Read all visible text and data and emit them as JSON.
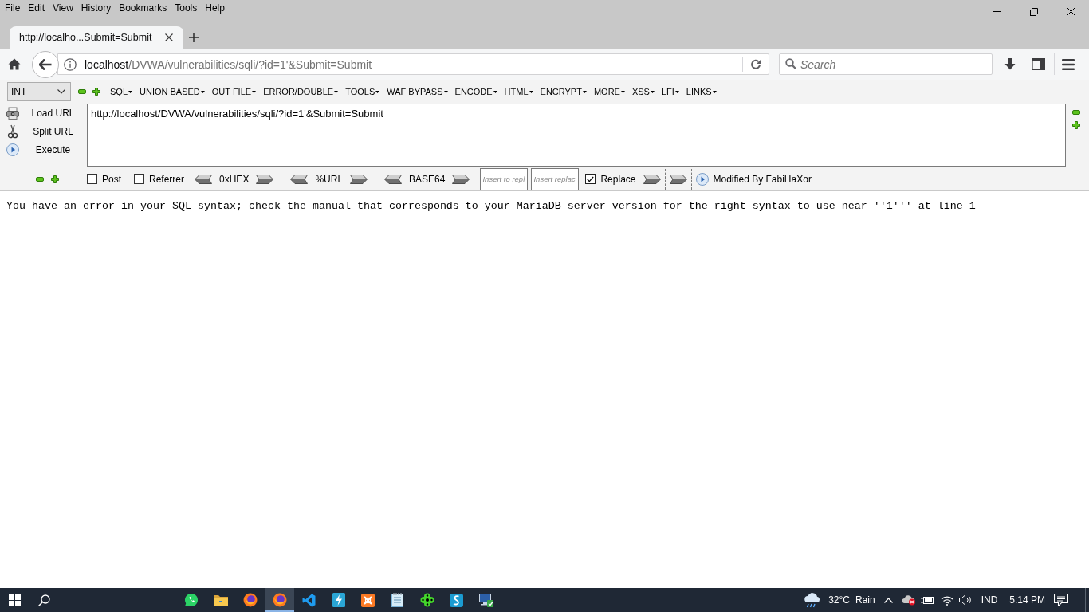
{
  "menu_bar": {
    "items": [
      "File",
      "Edit",
      "View",
      "History",
      "Bookmarks",
      "Tools",
      "Help"
    ]
  },
  "tabs": [
    {
      "title": "http://localho...Submit=Submit",
      "selected": true
    }
  ],
  "address_bar": {
    "host": "localhost",
    "path": "/DVWA/vulnerabilities/sqli/?id=1'&Submit=Submit"
  },
  "search": {
    "placeholder": "Search"
  },
  "hackbar": {
    "type_select": {
      "value": "INT"
    },
    "menus": [
      "SQL",
      "UNION BASED",
      "OUT FILE",
      "ERROR/DOUBLE",
      "TOOLS",
      "WAF BYPASS",
      "ENCODE",
      "HTML",
      "ENCRYPT",
      "MORE",
      "XSS",
      "LFI",
      "LINKS"
    ],
    "actions": [
      {
        "kind": "load",
        "label": "Load URL"
      },
      {
        "kind": "split",
        "label": "Split URL"
      },
      {
        "kind": "execute",
        "label": "Execute"
      }
    ],
    "url_box": {
      "value": "http://localhost/DVWA/vulnerabilities/sqli/?id=1'&Submit=Submit"
    },
    "options": [
      {
        "label": "Post",
        "checked": false
      },
      {
        "label": "Referrer",
        "checked": false
      }
    ],
    "encoders": [
      "0xHEX",
      "%URL",
      "BASE64"
    ],
    "replace_fields": [
      {
        "placeholder": "Insert to repl"
      },
      {
        "placeholder": "Insert replac"
      }
    ],
    "replace": {
      "label": "Replace",
      "checked": true
    },
    "credit": "Modified By FabiHaXor"
  },
  "page": {
    "error_message": "You have an error in your SQL syntax; check the manual that corresponds to your MariaDB server version for the right syntax to use near ''1''' at line 1"
  },
  "taskbar": {
    "apps": [
      {
        "kind": "chat",
        "selected": false
      },
      {
        "kind": "folder",
        "selected": false
      },
      {
        "kind": "browser",
        "selected": false
      },
      {
        "kind": "browser",
        "selected": true
      },
      {
        "kind": "editor",
        "selected": false
      },
      {
        "kind": "bolt",
        "selected": false
      },
      {
        "kind": "server",
        "selected": false
      },
      {
        "kind": "notepad",
        "selected": false
      },
      {
        "kind": "game",
        "selected": false
      },
      {
        "kind": "script",
        "selected": false
      },
      {
        "kind": "remote",
        "selected": false
      }
    ],
    "weather": {
      "temperature": "32°C",
      "condition": "Rain"
    },
    "language": "IND",
    "time": "5:14 PM"
  }
}
